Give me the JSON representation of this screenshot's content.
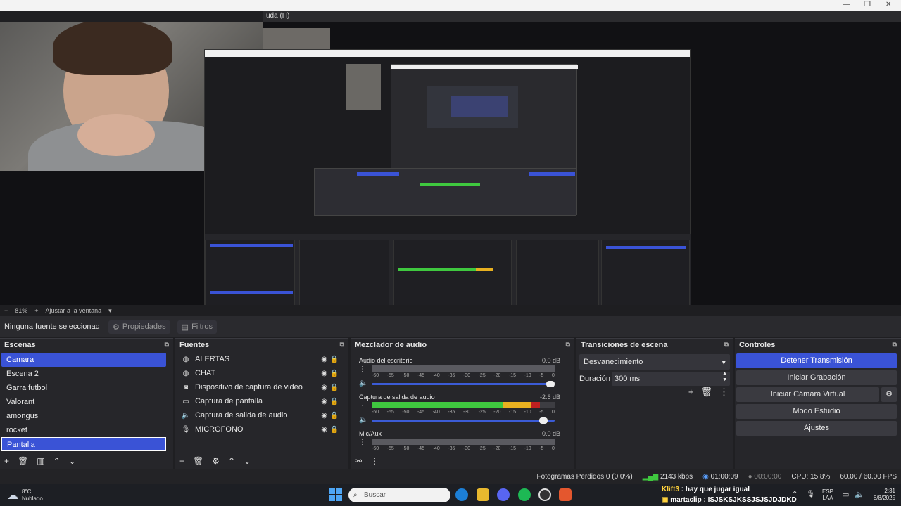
{
  "menubar": {
    "help": "uda (H)"
  },
  "window_controls": {
    "minimize": "—",
    "maximize": "❐",
    "close": "✕"
  },
  "zoom": {
    "minus": "−",
    "level": "81%",
    "plus": "+",
    "fit": "Ajustar a la ventana",
    "dropdown": "▾"
  },
  "source_toolbar": {
    "no_source": "Ninguna fuente seleccionad",
    "properties": "Propiedades",
    "filters": "Filtros"
  },
  "scenes": {
    "title": "Escenas",
    "items": [
      "Camara",
      "Escena 2",
      "Garra futbol",
      "Valorant",
      "amongus",
      "rocket",
      "Pantalla"
    ]
  },
  "sources": {
    "title": "Fuentes",
    "items": [
      {
        "label": "ALERTAS",
        "icon": "globe-icon"
      },
      {
        "label": "CHAT",
        "icon": "globe-icon"
      },
      {
        "label": "Dispositivo de captura de video",
        "icon": "camera-icon"
      },
      {
        "label": "Captura de pantalla",
        "icon": "monitor-icon"
      },
      {
        "label": "Captura de salida de audio",
        "icon": "speaker-icon"
      },
      {
        "label": "MICROFONO",
        "icon": "microphone-icon"
      }
    ]
  },
  "mixer": {
    "title": "Mezclador de audio",
    "ticks": [
      "-60",
      "-55",
      "-50",
      "-45",
      "-40",
      "-35",
      "-30",
      "-25",
      "-20",
      "-15",
      "-10",
      "-5",
      "0"
    ],
    "channels": [
      {
        "name": "Audio del escritorio",
        "db": "0.0 dB",
        "level": 0.0
      },
      {
        "name": "Captura de salida de audio",
        "db": "-2.6 dB",
        "level": 0.92
      },
      {
        "name": "Mic/Aux",
        "db": "0.0 dB",
        "level": 0.0
      }
    ]
  },
  "transitions": {
    "title": "Transiciones de escena",
    "selected": "Desvanecimiento",
    "duration_label": "Duración",
    "duration_value": "300 ms"
  },
  "controls": {
    "title": "Controles",
    "stop_stream": "Detener Transmisión",
    "start_recording": "Iniciar Grabación",
    "virtual_camera": "Iniciar Cámara Virtual",
    "studio_mode": "Modo Estudio",
    "settings": "Ajustes"
  },
  "status": {
    "dropped_frames": "Fotogramas Perdidos 0 (0.0%)",
    "bitrate": "2143 kbps",
    "stream_time": "01:00:09",
    "rec_time": "00:00:00",
    "cpu": "CPU: 15.8%",
    "fps": "60.00 / 60.00 FPS"
  },
  "taskbar": {
    "weather_temp": "8°C",
    "weather_desc": "Nublado",
    "search_placeholder": "Buscar",
    "lang": "ESP",
    "region": "LAA",
    "time": "2:31",
    "date": "8/8/2025"
  },
  "chat_overlay": [
    {
      "user": "Klift3",
      "message": "hay que jugar igual"
    },
    {
      "user": "martaclip",
      "message": "ISJSKSJKSSJSJSJDJDKD"
    }
  ],
  "colors": {
    "accent": "#3a53d6",
    "panel": "#26262a",
    "meter_green": "#3fc83f",
    "meter_yellow": "#e8b020",
    "meter_red": "#c02020"
  }
}
